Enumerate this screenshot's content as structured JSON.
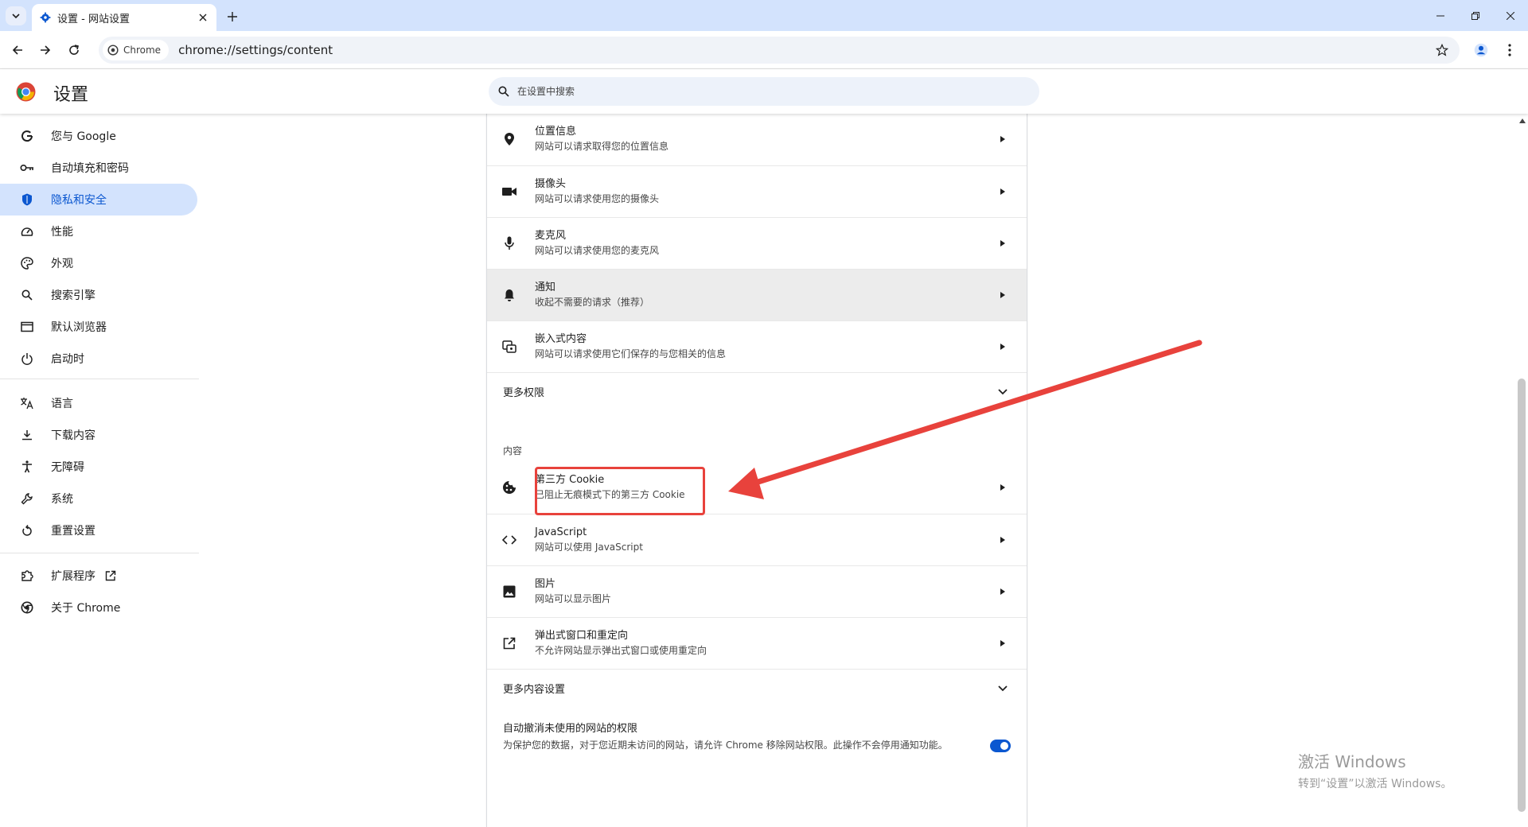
{
  "tab": {
    "title": "设置 - 网站设置"
  },
  "toolbar": {
    "chip_label": "Chrome",
    "url": "chrome://settings/content"
  },
  "header": {
    "title": "设置",
    "search_placeholder": "在设置中搜索"
  },
  "sidebar": {
    "items": [
      {
        "label": "您与 Google",
        "icon": "google-icon"
      },
      {
        "label": "自动填充和密码",
        "icon": "key-icon"
      },
      {
        "label": "隐私和安全",
        "icon": "shield-icon",
        "active": true
      },
      {
        "label": "性能",
        "icon": "speedometer-icon"
      },
      {
        "label": "外观",
        "icon": "palette-icon"
      },
      {
        "label": "搜索引擎",
        "icon": "search-icon"
      },
      {
        "label": "默认浏览器",
        "icon": "browser-window-icon"
      },
      {
        "label": "启动时",
        "icon": "power-icon"
      },
      {
        "label": "语言",
        "icon": "translate-icon"
      },
      {
        "label": "下载内容",
        "icon": "download-icon"
      },
      {
        "label": "无障碍",
        "icon": "accessibility-icon"
      },
      {
        "label": "系统",
        "icon": "wrench-icon"
      },
      {
        "label": "重置设置",
        "icon": "reset-icon"
      },
      {
        "label": "扩展程序",
        "icon": "puzzle-icon"
      },
      {
        "label": "关于 Chrome",
        "icon": "chrome-icon"
      }
    ]
  },
  "permissions": [
    {
      "title": "位置信息",
      "sub": "网站可以请求取得您的位置信息",
      "icon": "location-pin-icon"
    },
    {
      "title": "摄像头",
      "sub": "网站可以请求使用您的摄像头",
      "icon": "camera-icon"
    },
    {
      "title": "麦克风",
      "sub": "网站可以请求使用您的麦克风",
      "icon": "microphone-icon"
    },
    {
      "title": "通知",
      "sub": "收起不需要的请求（推荐）",
      "icon": "bell-icon"
    },
    {
      "title": "嵌入式内容",
      "sub": "网站可以请求使用它们保存的与您相关的信息",
      "icon": "embedded-content-icon"
    }
  ],
  "more_permissions": "更多权限",
  "content_heading": "内容",
  "content": [
    {
      "title": "第三方 Cookie",
      "sub": "已阻止无痕模式下的第三方 Cookie",
      "icon": "cookie-icon"
    },
    {
      "title": "JavaScript",
      "sub": "网站可以使用 JavaScript",
      "icon": "code-icon"
    },
    {
      "title": "图片",
      "sub": "网站可以显示图片",
      "icon": "image-icon"
    },
    {
      "title": "弹出式窗口和重定向",
      "sub": "不允许网站显示弹出式窗口或使用重定向",
      "icon": "open-external-icon"
    }
  ],
  "more_content": "更多内容设置",
  "auto_revoke": {
    "title": "自动撤消未使用的网站的权限",
    "sub": "为保护您的数据，对于您近期未访问的网站，请允许 Chrome 移除网站权限。此操作不会停用通知功能。",
    "enabled": true
  },
  "watermark": {
    "line1": "激活 Windows",
    "line2": "转到“设置”以激活 Windows。"
  },
  "colors": {
    "accent": "#0b57d0",
    "active_bg": "#d3e3fd",
    "annotation": "#e8423c"
  }
}
